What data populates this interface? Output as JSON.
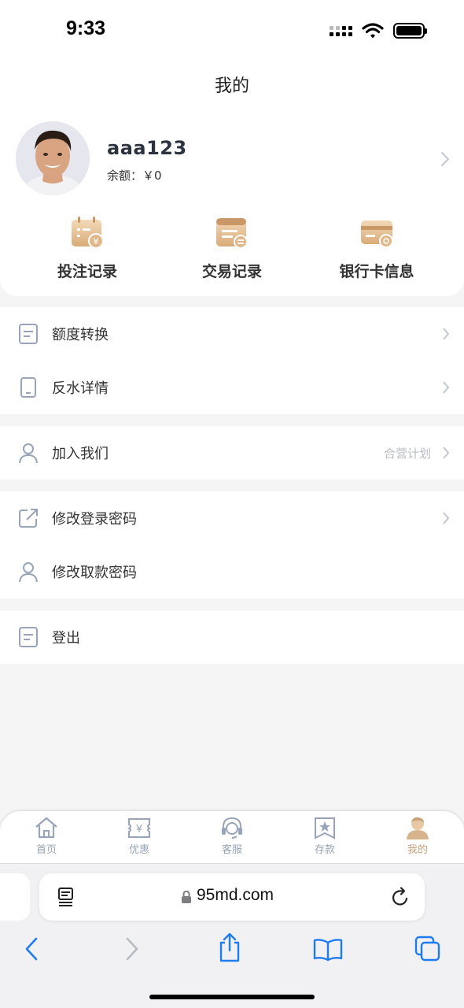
{
  "status_bar": {
    "time": "9:33"
  },
  "header": {
    "title": "我的"
  },
  "profile": {
    "username": "aaa123",
    "balance_label": "余额：",
    "balance_value": "￥0"
  },
  "quick_actions": [
    {
      "label": "投注记录",
      "icon": "bet-record-icon"
    },
    {
      "label": "交易记录",
      "icon": "transaction-record-icon"
    },
    {
      "label": "银行卡信息",
      "icon": "bank-card-icon"
    }
  ],
  "menu": {
    "quota_transfer": "额度转换",
    "rebate_details": "反水详情",
    "join_us": "加入我们",
    "join_us_extra": "合营计划",
    "change_login_password": "修改登录密码",
    "change_withdraw_password": "修改取款密码",
    "logout": "登出"
  },
  "tabs": [
    {
      "label": "首页",
      "icon": "home-icon"
    },
    {
      "label": "优惠",
      "icon": "promotion-ticket-icon"
    },
    {
      "label": "客服",
      "icon": "headset-icon"
    },
    {
      "label": "存款",
      "icon": "deposit-bookmark-icon"
    },
    {
      "label": "我的",
      "icon": "user-avatar-icon",
      "active": true
    }
  ],
  "browser": {
    "url": "95md.com"
  },
  "colors": {
    "accent": "#c9a27a",
    "icon": "#98a4b8",
    "text": "#333333"
  }
}
